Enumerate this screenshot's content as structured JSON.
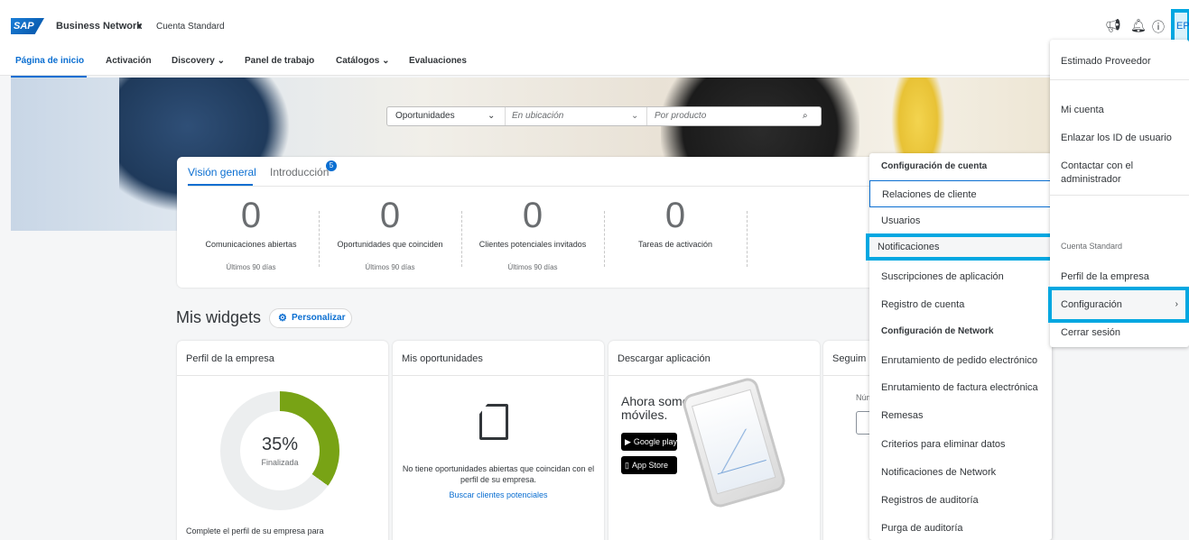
{
  "header": {
    "logo": "SAP",
    "product": "Business Network",
    "account_type": "Cuenta Standard",
    "avatar_initials": "EP",
    "icons": [
      "megaphone-icon",
      "bell-icon",
      "help-icon"
    ]
  },
  "nav": {
    "items": [
      {
        "label": "Página de inicio",
        "active": true
      },
      {
        "label": "Activación"
      },
      {
        "label": "Discovery",
        "has_dropdown": true
      },
      {
        "label": "Panel de trabajo"
      },
      {
        "label": "Catálogos",
        "has_dropdown": true
      },
      {
        "label": "Evaluaciones"
      }
    ]
  },
  "search": {
    "type_value": "Oportunidades",
    "location_placeholder": "En ubicación",
    "product_placeholder": "Por producto"
  },
  "overview": {
    "tabs": [
      {
        "label": "Visión general",
        "active": true
      },
      {
        "label": "Introducción"
      }
    ],
    "intro_badge": "5",
    "stats": [
      {
        "value": "0",
        "label": "Comunicaciones abiertas",
        "sub": "Últimos 90 días"
      },
      {
        "value": "0",
        "label": "Oportunidades que coinciden",
        "sub": "Últimos 90 días"
      },
      {
        "value": "0",
        "label": "Clientes potenciales invitados",
        "sub": "Últimos 90 días"
      },
      {
        "value": "0",
        "label": "Tareas de activación",
        "sub": ""
      }
    ]
  },
  "widgets": {
    "title": "Mis widgets",
    "customize_label": "Personalizar",
    "profile": {
      "title": "Perfil de la empresa",
      "percent": "35%",
      "percent_value": 35,
      "status": "Finalizada",
      "footer": "Complete el perfil de su empresa para"
    },
    "opportunities": {
      "title": "Mis oportunidades",
      "empty_text": "No tiene oportunidades abiertas que coincidan con el perfil de su empresa.",
      "link": "Buscar clientes potenciales"
    },
    "download": {
      "title": "Descargar aplicación",
      "headline": "Ahora somos móviles.",
      "google_play": "Google play",
      "app_store": "App Store"
    },
    "tracking": {
      "title": "Seguim",
      "label": "Núm"
    }
  },
  "account_config_menu": {
    "items": [
      {
        "label": "Configuración de cuenta",
        "kind": "header"
      },
      {
        "label": "Relaciones de cliente",
        "kind": "outlined"
      },
      {
        "label": "Usuarios"
      },
      {
        "label": "Notificaciones",
        "kind": "highlight"
      },
      {
        "label": "Suscripciones de aplicación"
      },
      {
        "label": "Registro de cuenta"
      },
      {
        "label": "Configuración de Network",
        "kind": "header"
      },
      {
        "label": "Enrutamiento de pedido electrónico"
      },
      {
        "label": "Enrutamiento de factura electrónica"
      },
      {
        "label": "Remesas"
      },
      {
        "label": "Criterios para eliminar datos"
      },
      {
        "label": "Notificaciones de Network"
      },
      {
        "label": "Registros de auditoría"
      },
      {
        "label": "Purga de auditoría"
      }
    ]
  },
  "user_menu": {
    "greeting": "Estimado Proveedor",
    "items": [
      "Mi cuenta",
      "Enlazar los ID de usuario",
      "Contactar con el administrador"
    ],
    "section_label": "Cuenta Standard",
    "company_profile": "Perfil de la empresa",
    "settings": "Configuración",
    "logout": "Cerrar sesión"
  }
}
